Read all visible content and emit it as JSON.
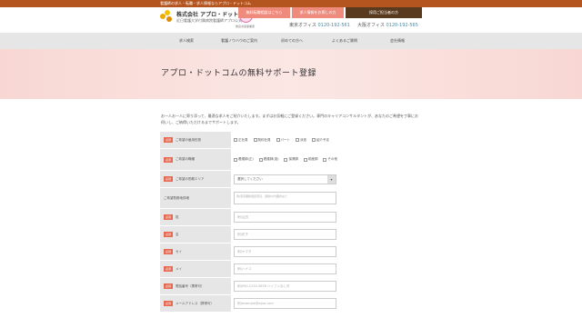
{
  "topbar": {
    "text": "看護師の求人・転職・求人情報ならアプロ・ドットコム"
  },
  "header": {
    "logo_name": "株式会社 アプロ・ドットコム",
    "logo_sub": "近日看護大学付属病院看護師アプロ公式",
    "badge_text": "優良派遣事業者",
    "btn_register": "無料転職相談はこちら",
    "btn_job": "求人情報をお探しの方",
    "btn_company": "採用ご担当者の方",
    "phone1_label": "東京オフィス",
    "phone1": "0120-192-561",
    "phone2_label": "大阪オフィス",
    "phone2": "0120-192-565"
  },
  "nav": [
    "求人検索",
    "看護ノウハウのご案内",
    "初めての方へ",
    "よくあるご質問",
    "会社情報"
  ],
  "hero": {
    "title": "アプロ・ドットコムの無料サポート登録"
  },
  "intro": "お一人お一人に寄り添って、最適な求人をご紹介いたします。まずはお気軽にご登録ください。専門のキャリアコンサルタントが、あなたのご希望を丁寧にお伺いし、ご納得いただけるまでサポートします。",
  "form": {
    "required": "必須",
    "rows": [
      {
        "label": "ご希望の雇用形態",
        "required": true,
        "type": "checks",
        "options": [
          "正社員",
          "契約社員",
          "パート",
          "派遣",
          "紹介予定"
        ]
      },
      {
        "label": "ご希望の職種",
        "required": true,
        "type": "checks",
        "options": [
          "看護師(正)",
          "看護師(准)",
          "保健師",
          "助産師",
          "その他"
        ]
      },
      {
        "label": "ご希望の勤務エリア",
        "required": true,
        "type": "select",
        "value": "選択してください"
      },
      {
        "label": "ご希望勤務地詳細",
        "required": false,
        "type": "textarea",
        "placeholder": "例)東京都新宿区周辺、通勤30分圏内など"
      },
      {
        "label": "姓",
        "required": true,
        "type": "input",
        "placeholder": "例)山田"
      },
      {
        "label": "名",
        "required": true,
        "type": "input",
        "placeholder": "例)花子"
      },
      {
        "label": "セイ",
        "required": true,
        "type": "input",
        "placeholder": "例)ヤマダ"
      },
      {
        "label": "メイ",
        "required": true,
        "type": "input",
        "placeholder": "例)ハナコ"
      },
      {
        "label": "電話番号（携帯可）",
        "required": true,
        "type": "input",
        "placeholder": "例)090-1234-5678 ハイフンなし可"
      },
      {
        "label": "メールアドレス（携帯可）",
        "required": true,
        "type": "input",
        "placeholder": "例)example@apro.com"
      }
    ]
  },
  "colors": {
    "accent": "#ef8b7d",
    "topbar": "#b4541e",
    "required": "#e46a54"
  }
}
